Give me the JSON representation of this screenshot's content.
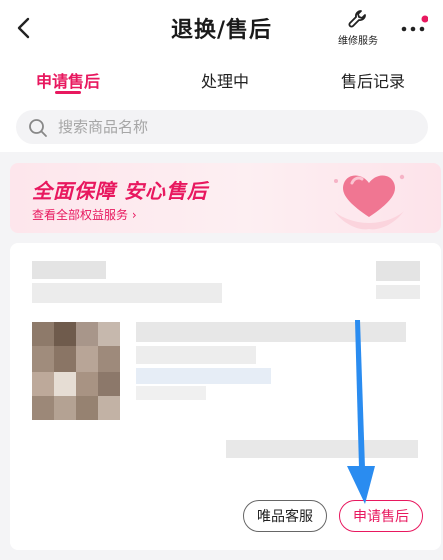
{
  "header": {
    "title": "退换/售后",
    "service_label": "维修服务"
  },
  "tabs": [
    {
      "label": "申请售后",
      "active": true
    },
    {
      "label": "处理中",
      "active": false
    },
    {
      "label": "售后记录",
      "active": false
    }
  ],
  "search": {
    "placeholder": "搜索商品名称"
  },
  "banner": {
    "title": "全面保障  安心售后",
    "link": "查看全部权益服务 ›"
  },
  "order_card": {
    "buttons": {
      "service": "唯品客服",
      "apply": "申请售后"
    }
  },
  "colors": {
    "accent": "#e8185f",
    "annotation_arrow": "#2a8cf0"
  }
}
